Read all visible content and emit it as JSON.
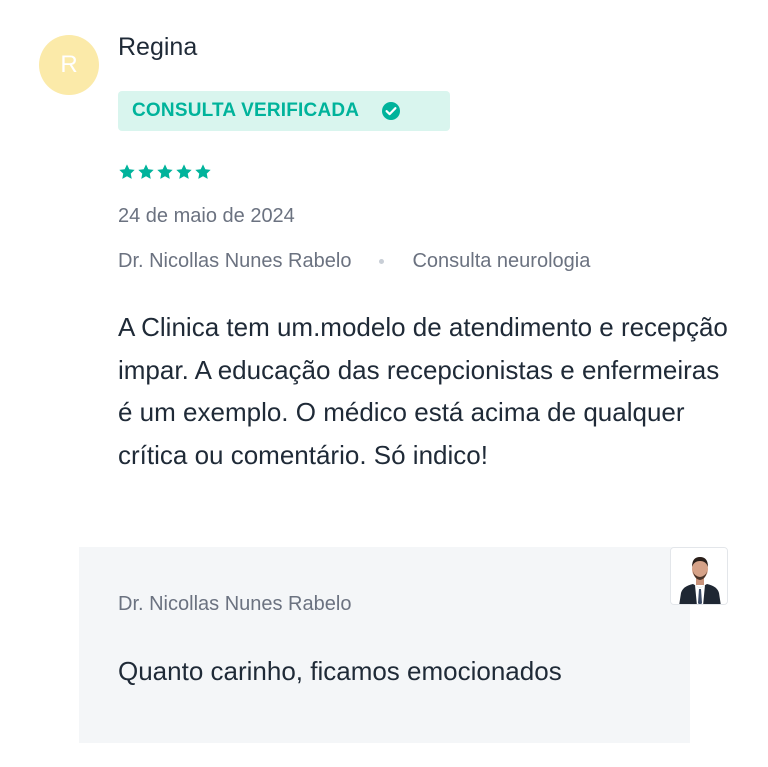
{
  "review": {
    "avatar_initial": "R",
    "reviewer_name": "Regina",
    "verified_badge": "CONSULTA VERIFICADA",
    "rating": 5,
    "date": "24 de maio de 2024",
    "doctor_name": "Dr. Nicollas Nunes Rabelo",
    "service": "Consulta neurologia",
    "text": "A Clinica tem um.modelo de atendimento e recepção impar. A educação das recepcionistas e enfermeiras é um exemplo. O médico está acima de qualquer crítica ou comentário. Só indico!"
  },
  "reply": {
    "author": "Dr. Nicollas Nunes Rabelo",
    "text": "Quanto carinho, ficamos emocionados"
  },
  "colors": {
    "accent": "#00b39b",
    "badge_background": "#d9f5ee",
    "avatar_background": "#fbeaa9",
    "reply_background": "#f4f6f8",
    "muted_text": "#6b7280"
  },
  "icons": {
    "verified": "check-circle-icon",
    "rating": "star-icon",
    "separator": "dot-icon",
    "doctor_photo": "doctor-avatar-icon"
  }
}
